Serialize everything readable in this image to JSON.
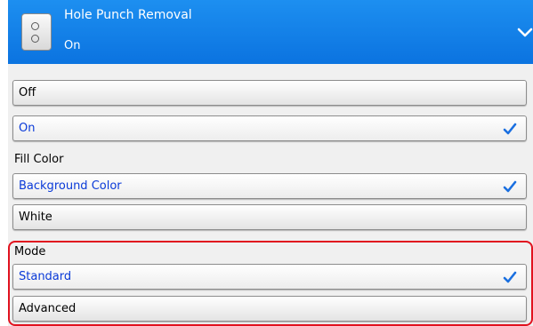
{
  "header": {
    "title": "Hole Punch Removal",
    "value": "On",
    "icon": "hole-punch-document-icon",
    "accent_color": "#0b73e0"
  },
  "options": {
    "off": "Off",
    "on": "On"
  },
  "fill_color": {
    "label": "Fill Color",
    "background": "Background Color",
    "white": "White"
  },
  "mode": {
    "label": "Mode",
    "standard": "Standard",
    "advanced": "Advanced",
    "highlight_color": "#e1121f"
  },
  "selection_color": "#0a3ad8",
  "check_color": "#1a6fe0"
}
